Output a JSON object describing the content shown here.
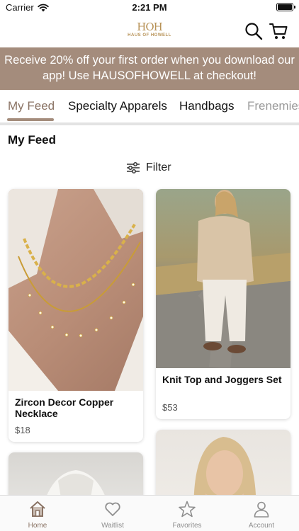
{
  "status_bar": {
    "carrier": "Carrier",
    "time": "2:21 PM"
  },
  "header": {
    "logo_mark": "HOH",
    "logo_text": "HAUS OF HOWELL",
    "icons": [
      "search-icon",
      "cart-icon"
    ]
  },
  "promo_banner": "Receive 20% off your first order when you download our app!  Use HAUSOFHOWELL at checkout!",
  "tabs": [
    {
      "label": "My Feed",
      "active": true
    },
    {
      "label": "Specialty Apparels",
      "active": false
    },
    {
      "label": "Handbags",
      "active": false
    },
    {
      "label": "Frenemies",
      "active": false
    }
  ],
  "feed": {
    "title": "My Feed",
    "filter_label": "Filter",
    "products": [
      {
        "name": "Zircon Decor Copper Necklace",
        "price": "$18"
      },
      {
        "name": "Knit Top and Joggers Set",
        "price": "$53"
      },
      {
        "name": "",
        "price": ""
      },
      {
        "name": "",
        "price": ""
      }
    ]
  },
  "bottom_nav": [
    {
      "label": "Home",
      "icon": "home-icon",
      "active": true
    },
    {
      "label": "Waitlist",
      "icon": "heart-icon",
      "active": false
    },
    {
      "label": "Favorites",
      "icon": "star-icon",
      "active": false
    },
    {
      "label": "Account",
      "icon": "person-icon",
      "active": false
    }
  ],
  "colors": {
    "accent": "#a48c7c",
    "accent_text": "#8a7364",
    "logo_gold": "#b79256"
  }
}
